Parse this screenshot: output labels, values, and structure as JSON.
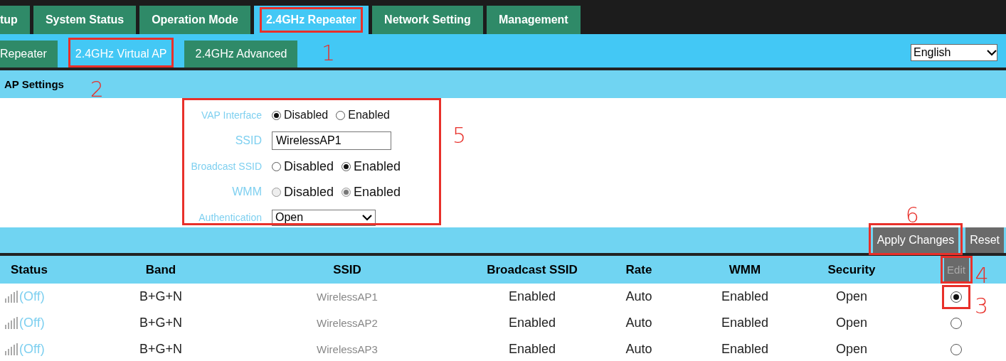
{
  "top_tabs": [
    {
      "label": "tup",
      "selected": false,
      "highlighted": false
    },
    {
      "label": "System Status",
      "selected": false,
      "highlighted": false
    },
    {
      "label": "Operation Mode",
      "selected": false,
      "highlighted": false
    },
    {
      "label": "2.4GHz Repeater",
      "selected": true,
      "highlighted": true,
      "note": "1"
    },
    {
      "label": "Network Setting",
      "selected": false,
      "highlighted": false
    },
    {
      "label": "Management",
      "selected": false,
      "highlighted": false
    }
  ],
  "sub_tabs": [
    {
      "label": "Repeater",
      "selected": false,
      "highlighted": false
    },
    {
      "label": "2.4GHz Virtual AP",
      "selected": true,
      "highlighted": true,
      "note": "2"
    },
    {
      "label": "2.4GHz Advanced",
      "selected": false,
      "highlighted": false
    }
  ],
  "language": {
    "value": "English"
  },
  "section_title": "AP Settings",
  "form": {
    "highlighted": true,
    "note": "5",
    "fields": [
      {
        "kind": "radio",
        "label": "VAP Interface",
        "disabled": false,
        "options": [
          {
            "label": "Disabled",
            "selected": true
          },
          {
            "label": "Enabled",
            "selected": false
          }
        ]
      },
      {
        "kind": "text",
        "label": "SSID",
        "value": "WirelessAP1"
      },
      {
        "kind": "radio",
        "label": "Broadcast SSID",
        "disabled": false,
        "options": [
          {
            "label": "Disabled",
            "selected": false
          },
          {
            "label": "Enabled",
            "selected": true
          }
        ]
      },
      {
        "kind": "radio",
        "label": "WMM",
        "disabled": true,
        "options": [
          {
            "label": "Disabled",
            "selected": false
          },
          {
            "label": "Enabled",
            "selected": true
          }
        ]
      },
      {
        "kind": "select",
        "label": "Authentication",
        "value": "Open"
      }
    ]
  },
  "buttons": [
    {
      "label": "Apply Changes",
      "highlighted": true,
      "note": "6"
    },
    {
      "label": "Reset",
      "highlighted": false
    }
  ],
  "table": {
    "columns": [
      "Status",
      "Band",
      "SSID",
      "Broadcast SSID",
      "Rate",
      "WMM",
      "Security"
    ],
    "edit_button": {
      "label": "Edit",
      "disabled": true,
      "highlighted": true,
      "note": "4"
    },
    "rows": [
      {
        "status": "(Off)",
        "band": "B+G+N",
        "ssid": "WirelessAP1",
        "broadcast_ssid": "Enabled",
        "rate": "Auto",
        "wmm": "Enabled",
        "security": "Open",
        "selected": true,
        "highlighted": true,
        "note": "3"
      },
      {
        "status": "(Off)",
        "band": "B+G+N",
        "ssid": "WirelessAP2",
        "broadcast_ssid": "Enabled",
        "rate": "Auto",
        "wmm": "Enabled",
        "security": "Open",
        "selected": false,
        "highlighted": false
      },
      {
        "status": "(Off)",
        "band": "B+G+N",
        "ssid": "WirelessAP3",
        "broadcast_ssid": "Enabled",
        "rate": "Auto",
        "wmm": "Enabled",
        "security": "Open",
        "selected": false,
        "highlighted": false
      }
    ]
  }
}
